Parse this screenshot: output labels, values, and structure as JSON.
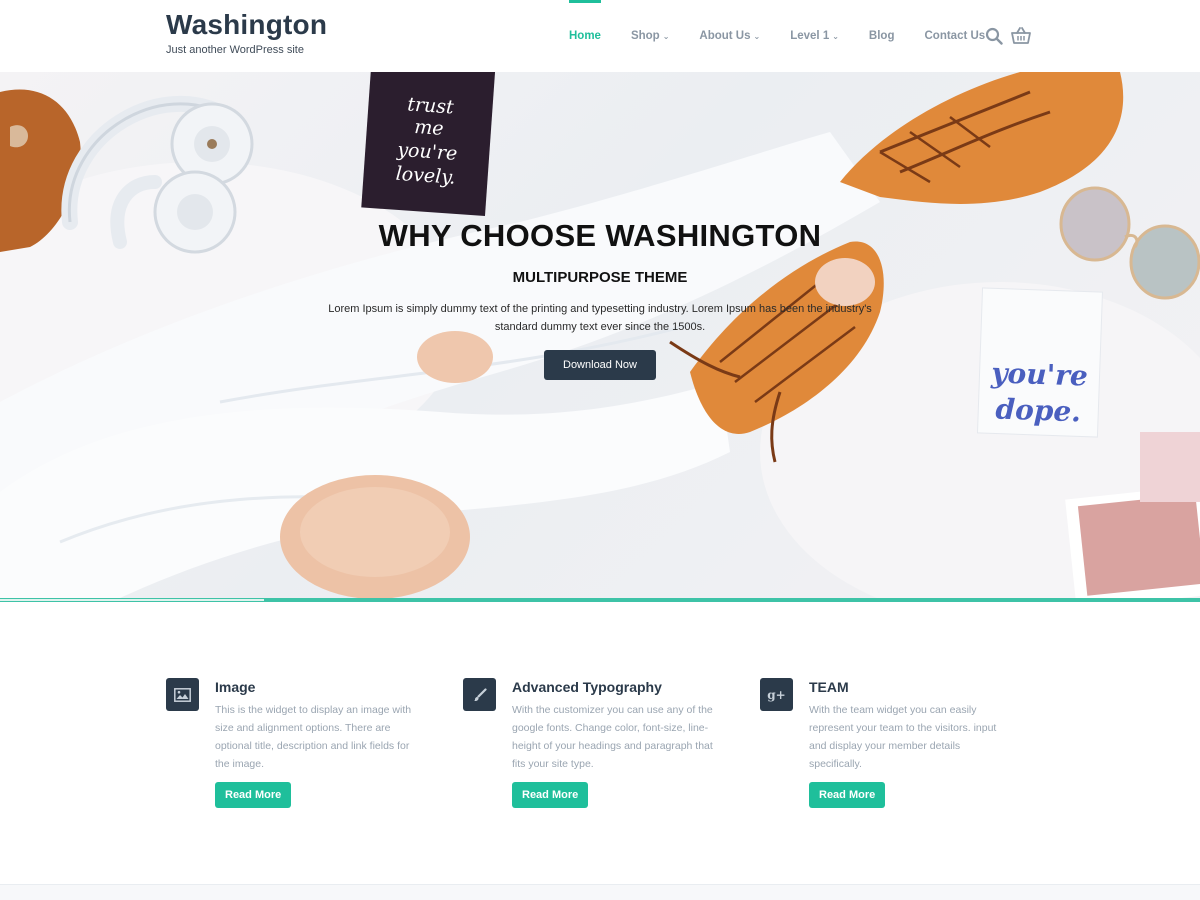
{
  "header": {
    "site_title": "Washington",
    "tagline": "Just another WordPress site",
    "nav": [
      {
        "label": "Home",
        "active": true,
        "dropdown": false
      },
      {
        "label": "Shop",
        "active": false,
        "dropdown": true
      },
      {
        "label": "About Us",
        "active": false,
        "dropdown": true
      },
      {
        "label": "Level 1",
        "active": false,
        "dropdown": true
      },
      {
        "label": "Blog",
        "active": false,
        "dropdown": false
      },
      {
        "label": "Contact Us",
        "active": false,
        "dropdown": false
      }
    ],
    "icons": [
      "search-icon",
      "cart-icon"
    ]
  },
  "hero": {
    "title": "WHY CHOOSE WASHINGTON",
    "subtitle": "MULTIPURPOSE THEME",
    "text": "Lorem Ipsum is simply dummy text of the printing and typesetting industry. Lorem Ipsum has been the industry's standard dummy text ever since the 1500s.",
    "button": "Download Now",
    "note_card_1": "trust me you're lovely.",
    "note_card_2": "you're dope.",
    "slider_progress": 0.22
  },
  "features": [
    {
      "icon": "image-icon",
      "title": "Image",
      "text": "This is the widget to display an image with size and alignment options. There are optional title, description and link fields for the image.",
      "button": "Read More"
    },
    {
      "icon": "brush-icon",
      "title": "Advanced Typography",
      "text": "With the customizer you can use any of the google fonts. Change color, font-size, line-height of your headings and paragraph that fits your site type.",
      "button": "Read More"
    },
    {
      "icon": "google-plus-icon",
      "title": "TEAM",
      "text": "With the team widget you can easily represent your team to the visitors. input and display your member details specifically.",
      "button": "Read More"
    }
  ],
  "colors": {
    "accent": "#1fbf9b",
    "dark": "#2b3a4a",
    "muted": "#9aa5b1"
  }
}
